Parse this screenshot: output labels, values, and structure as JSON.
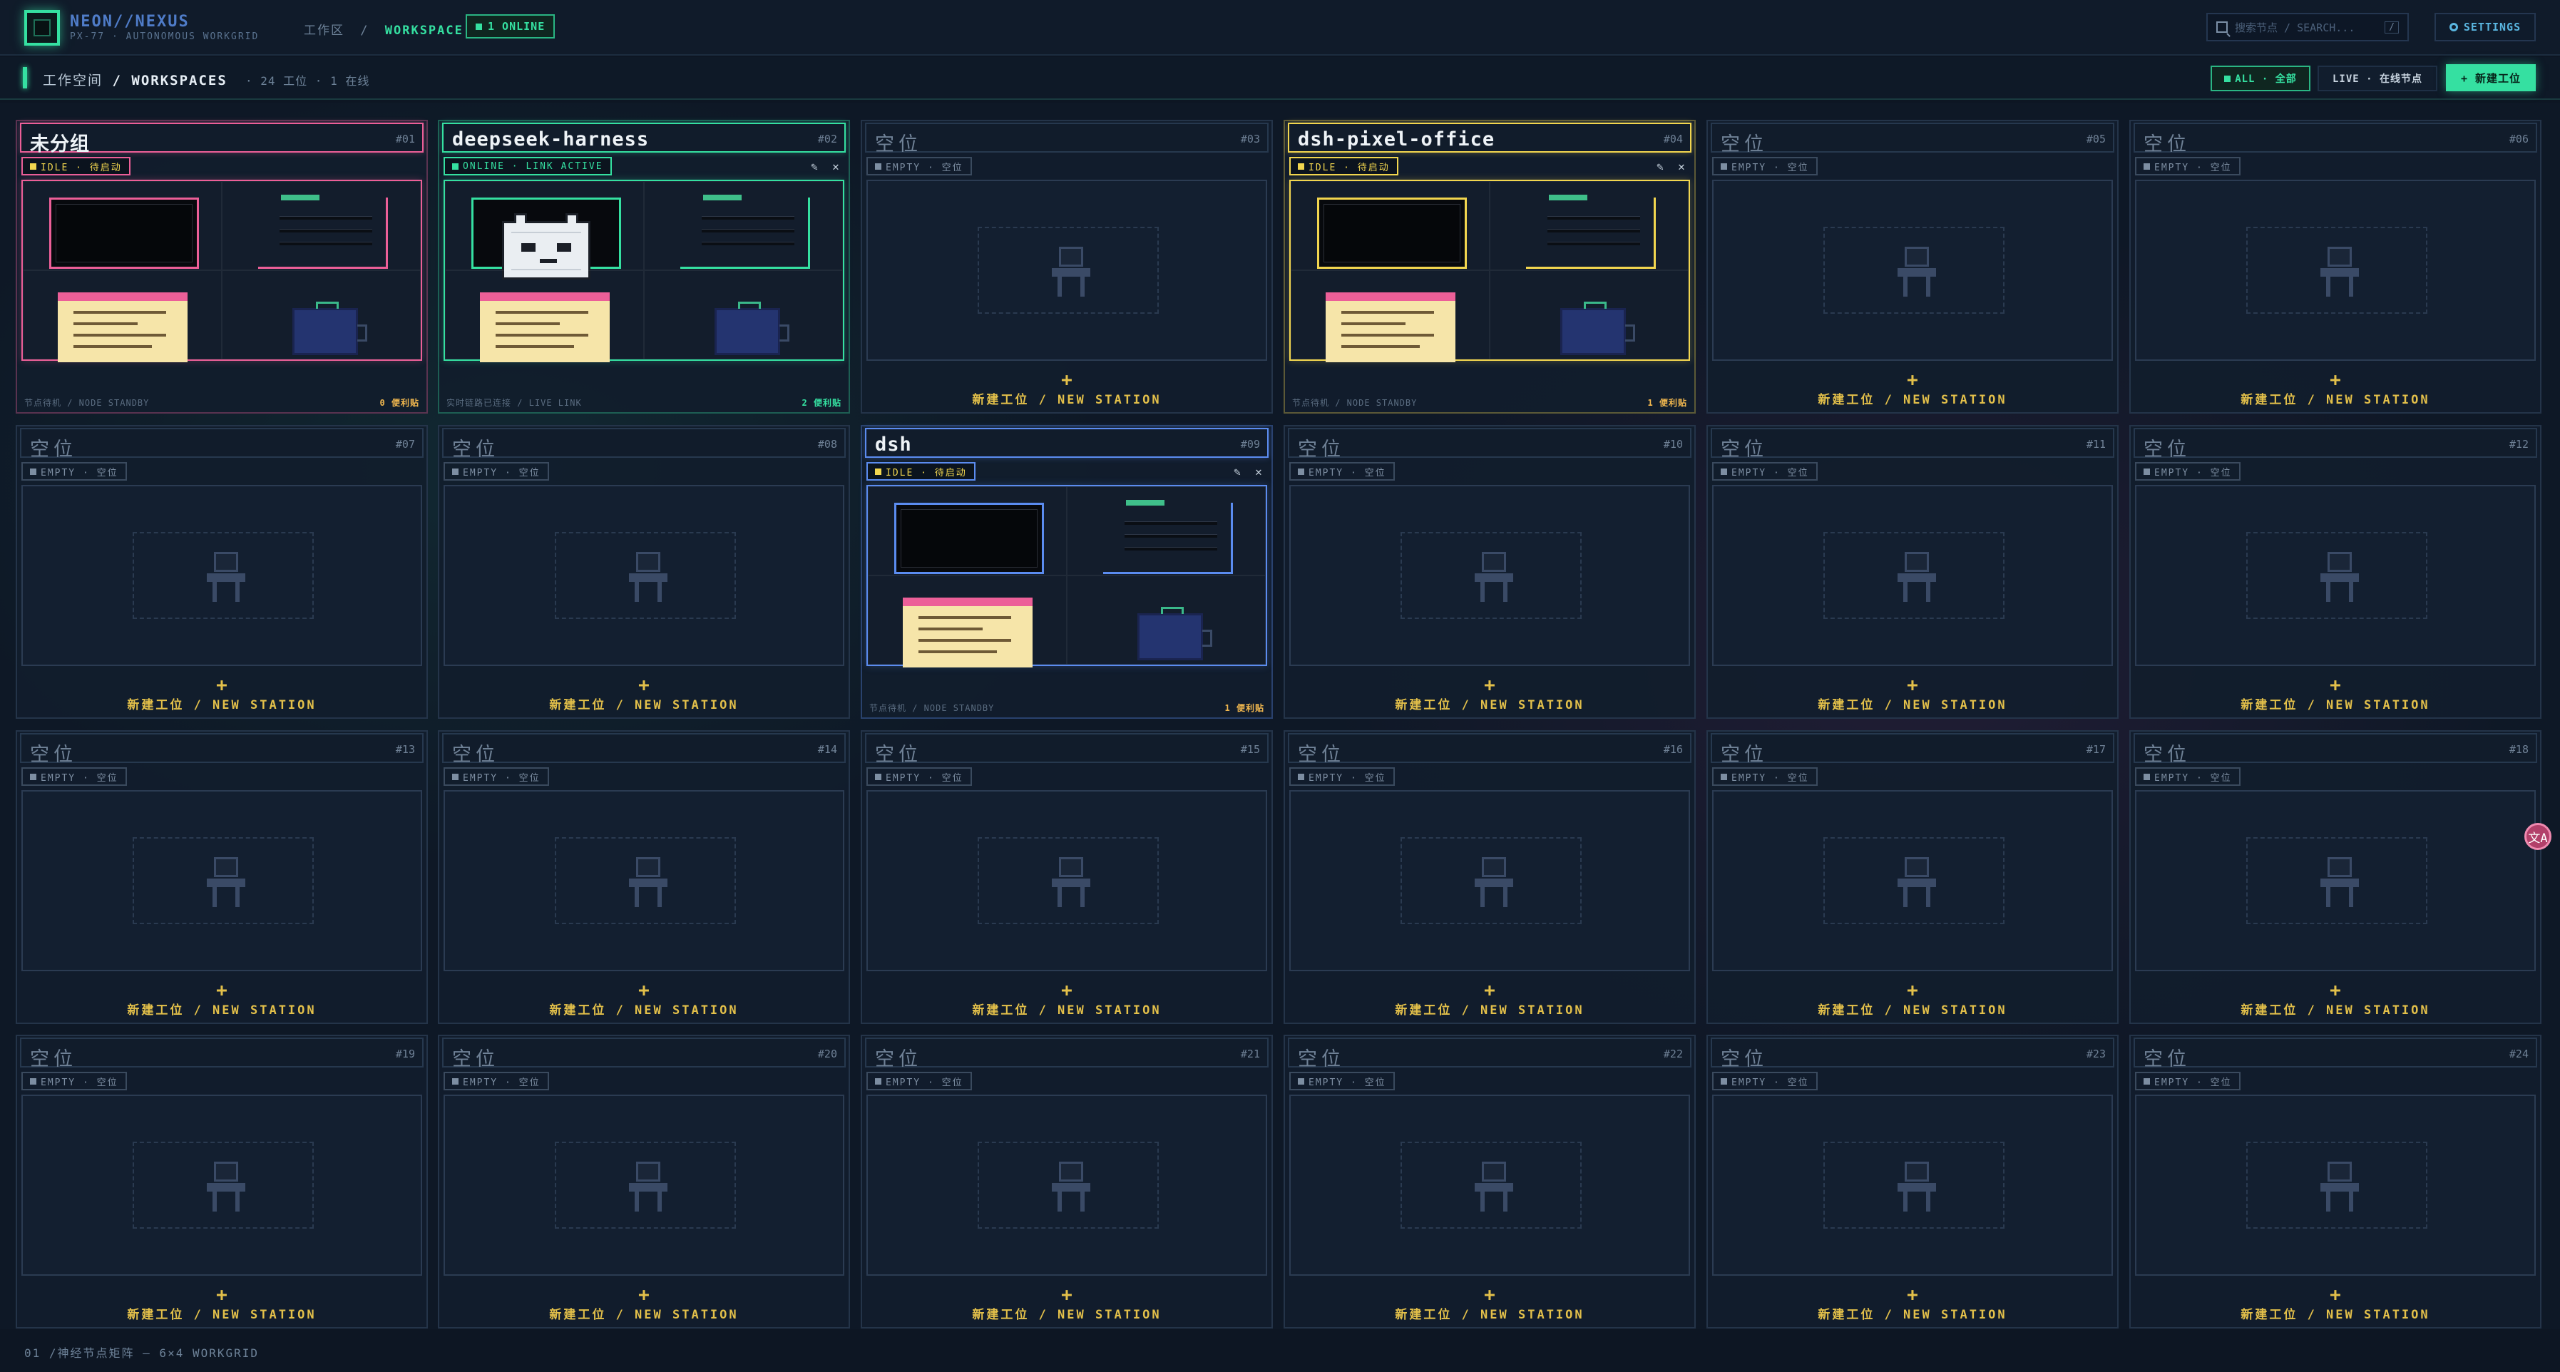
{
  "app": {
    "brand": "NEON//NEXUS",
    "subtitle": "PX-77 · AUTONOMOUS WORKGRID",
    "breadcrumb_root": "工作区",
    "breadcrumb_sep": "/",
    "breadcrumb_current": "WORKSPACE",
    "online_pill": "1 ONLINE",
    "search_placeholder": "搜索节点 / SEARCH...",
    "search_shortcut": "/",
    "settings_label": "SETTINGS"
  },
  "subbar": {
    "title_cn": "工作空间",
    "title_sep": "/",
    "title_en": "WORKSPACES",
    "stats": "· 24 工位 · 1 在线",
    "filter_all": "ALL · 全部",
    "filter_live": "LIVE · 在线节点",
    "new_button": "+ 新建工位"
  },
  "empty_card": {
    "title": "空位",
    "badge": "EMPTY · 空位",
    "plus": "+",
    "new_label": "新建工位 / NEW STATION"
  },
  "cards": [
    {
      "num": "#01",
      "name": "未分组",
      "status": "IDLE · 待启动",
      "foot": "节点待机 / NODE STANDBY",
      "count": "0 便利贴",
      "accent": "#ec5f98",
      "occupied": true,
      "screen": "monitor",
      "tools": false
    },
    {
      "num": "#02",
      "name": "deepseek-harness",
      "status": "ONLINE · LINK ACTIVE",
      "foot": "实时链路已连接 / LIVE LINK",
      "count": "2 便利贴",
      "accent": "#35e0a1",
      "occupied": true,
      "screen": "cat",
      "tools": true
    },
    {
      "num": "#03",
      "occupied": false
    },
    {
      "num": "#04",
      "name": "dsh-pixel-office",
      "status": "IDLE · 待启动",
      "foot": "节点待机 / NODE STANDBY",
      "count": "1 便利贴",
      "accent": "#f2d64f",
      "occupied": true,
      "screen": "monitor",
      "tools": true
    },
    {
      "num": "#05",
      "occupied": false
    },
    {
      "num": "#06",
      "occupied": false
    },
    {
      "num": "#07",
      "occupied": false
    },
    {
      "num": "#08",
      "occupied": false
    },
    {
      "num": "#09",
      "name": "dsh",
      "status": "IDLE · 待启动",
      "foot": "节点待机 / NODE STANDBY",
      "count": "1 便利贴",
      "accent": "#5b8cf0",
      "occupied": true,
      "screen": "monitor",
      "tools": true
    },
    {
      "num": "#10",
      "occupied": false
    },
    {
      "num": "#11",
      "occupied": false
    },
    {
      "num": "#12",
      "occupied": false
    },
    {
      "num": "#13",
      "occupied": false
    },
    {
      "num": "#14",
      "occupied": false
    },
    {
      "num": "#15",
      "occupied": false
    },
    {
      "num": "#16",
      "occupied": false
    },
    {
      "num": "#17",
      "occupied": false
    },
    {
      "num": "#18",
      "occupied": false
    },
    {
      "num": "#19",
      "occupied": false
    },
    {
      "num": "#20",
      "occupied": false
    },
    {
      "num": "#21",
      "occupied": false
    },
    {
      "num": "#22",
      "occupied": false
    },
    {
      "num": "#23",
      "occupied": false
    },
    {
      "num": "#24",
      "occupied": false
    }
  ],
  "footer": "01 /神经节点矩阵 — 6×4 WORKGRID",
  "floating_badge": "文A",
  "colors": {
    "accent_green": "#35e0a1",
    "accent_yellow": "#e3c04a",
    "accent_pink": "#ec5f98",
    "accent_blue": "#5b8cf0",
    "bg": "#0d1623"
  },
  "icons": {
    "logo": "square-logo-icon",
    "search": "search-icon",
    "settings": "gear-icon",
    "edit": "pencil-icon",
    "close": "close-icon",
    "chair": "chair-icon"
  }
}
